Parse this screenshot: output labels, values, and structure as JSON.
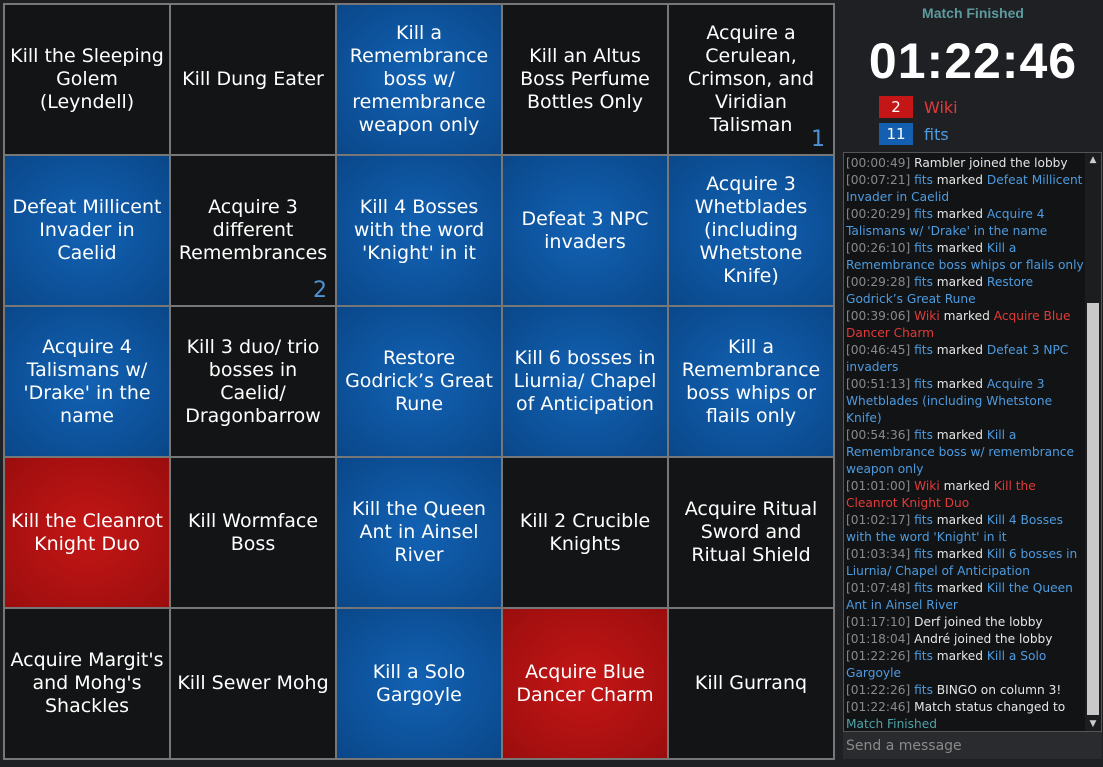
{
  "board": {
    "cells": [
      {
        "text": "Kill the Sleeping Golem (Leyndell)",
        "color": "none",
        "marker": ""
      },
      {
        "text": "Kill Dung Eater",
        "color": "none",
        "marker": ""
      },
      {
        "text": "Kill a Remembrance boss w/ remembrance weapon only",
        "color": "blue",
        "marker": ""
      },
      {
        "text": "Kill an Altus Boss Perfume Bottles Only",
        "color": "none",
        "marker": ""
      },
      {
        "text": "Acquire a Cerulean, Crimson, and Viridian Talisman",
        "color": "none",
        "marker": "1"
      },
      {
        "text": "Defeat Millicent Invader in Caelid",
        "color": "blue",
        "marker": ""
      },
      {
        "text": "Acquire 3 different Remembrances",
        "color": "none",
        "marker": "2"
      },
      {
        "text": "Kill 4 Bosses with the word 'Knight' in it",
        "color": "blue",
        "marker": ""
      },
      {
        "text": "Defeat 3 NPC invaders",
        "color": "blue",
        "marker": ""
      },
      {
        "text": "Acquire 3 Whetblades (including Whetstone Knife)",
        "color": "blue",
        "marker": ""
      },
      {
        "text": "Acquire 4 Talismans w/ 'Drake' in the name",
        "color": "blue",
        "marker": ""
      },
      {
        "text": "Kill 3 duo/ trio bosses in Caelid/ Dragonbarrow",
        "color": "none",
        "marker": ""
      },
      {
        "text": "Restore Godrick’s Great Rune",
        "color": "blue",
        "marker": ""
      },
      {
        "text": "Kill 6 bosses in Liurnia/ Chapel of Anticipation",
        "color": "blue",
        "marker": ""
      },
      {
        "text": "Kill a Remembrance boss whips or flails only",
        "color": "blue",
        "marker": ""
      },
      {
        "text": "Kill the Cleanrot Knight Duo",
        "color": "red",
        "marker": ""
      },
      {
        "text": "Kill Wormface Boss",
        "color": "none",
        "marker": ""
      },
      {
        "text": "Kill the Queen Ant in Ainsel River",
        "color": "blue",
        "marker": ""
      },
      {
        "text": "Kill 2 Crucible Knights",
        "color": "none",
        "marker": ""
      },
      {
        "text": "Acquire Ritual Sword and Ritual Shield",
        "color": "none",
        "marker": ""
      },
      {
        "text": "Acquire Margit's and Mohg's Shackles",
        "color": "none",
        "marker": ""
      },
      {
        "text": "Kill Sewer Mohg",
        "color": "none",
        "marker": ""
      },
      {
        "text": "Kill a Solo Gargoyle",
        "color": "blue",
        "marker": ""
      },
      {
        "text": "Acquire Blue Dancer Charm",
        "color": "red",
        "marker": ""
      },
      {
        "text": "Kill Gurranq",
        "color": "none",
        "marker": ""
      }
    ]
  },
  "status": {
    "title": "Match Finished",
    "timer": "01:22:46"
  },
  "teams": [
    {
      "count": "2",
      "name": "Wiki",
      "color": "#c41616"
    },
    {
      "count": "11",
      "name": "fits",
      "color": "#1460b0"
    }
  ],
  "chat": {
    "entries": [
      {
        "ts": "[00:00:49]",
        "player": "",
        "pcolor": "",
        "action": "Rambler joined the lobby",
        "goal": "",
        "gcolor": ""
      },
      {
        "ts": "[00:07:21]",
        "player": "fits",
        "pcolor": "blue",
        "action": " marked ",
        "goal": "Defeat Millicent Invader in Caelid",
        "gcolor": "blue"
      },
      {
        "ts": "[00:20:29]",
        "player": "fits",
        "pcolor": "blue",
        "action": " marked ",
        "goal": "Acquire 4 Talismans w/ 'Drake' in the name",
        "gcolor": "blue"
      },
      {
        "ts": "[00:26:10]",
        "player": "fits",
        "pcolor": "blue",
        "action": " marked ",
        "goal": "Kill a Remembrance boss whips or flails only",
        "gcolor": "blue"
      },
      {
        "ts": "[00:29:28]",
        "player": "fits",
        "pcolor": "blue",
        "action": " marked ",
        "goal": "Restore Godrick’s Great Rune",
        "gcolor": "blue"
      },
      {
        "ts": "[00:39:06]",
        "player": "Wiki",
        "pcolor": "red",
        "action": " marked ",
        "goal": "Acquire Blue Dancer Charm",
        "gcolor": "red"
      },
      {
        "ts": "[00:46:45]",
        "player": "fits",
        "pcolor": "blue",
        "action": " marked ",
        "goal": "Defeat 3 NPC invaders",
        "gcolor": "blue"
      },
      {
        "ts": "[00:51:13]",
        "player": "fits",
        "pcolor": "blue",
        "action": " marked ",
        "goal": "Acquire 3 Whetblades (including Whetstone Knife)",
        "gcolor": "blue"
      },
      {
        "ts": "[00:54:36]",
        "player": "fits",
        "pcolor": "blue",
        "action": " marked ",
        "goal": "Kill a Remembrance boss w/ remembrance weapon only",
        "gcolor": "blue"
      },
      {
        "ts": "[01:01:00]",
        "player": "Wiki",
        "pcolor": "red",
        "action": " marked ",
        "goal": "Kill the Cleanrot Knight Duo",
        "gcolor": "red"
      },
      {
        "ts": "[01:02:17]",
        "player": "fits",
        "pcolor": "blue",
        "action": " marked ",
        "goal": "Kill 4 Bosses with the word 'Knight' in it",
        "gcolor": "blue"
      },
      {
        "ts": "[01:03:34]",
        "player": "fits",
        "pcolor": "blue",
        "action": " marked ",
        "goal": "Kill 6 bosses in Liurnia/ Chapel of Anticipation",
        "gcolor": "blue"
      },
      {
        "ts": "[01:07:48]",
        "player": "fits",
        "pcolor": "blue",
        "action": " marked ",
        "goal": "Kill the Queen Ant in Ainsel River",
        "gcolor": "blue"
      },
      {
        "ts": "[01:17:10]",
        "player": "",
        "pcolor": "",
        "action": "Derf joined the lobby",
        "goal": "",
        "gcolor": ""
      },
      {
        "ts": "[01:18:04]",
        "player": "",
        "pcolor": "",
        "action": "André joined the lobby",
        "goal": "",
        "gcolor": ""
      },
      {
        "ts": "[01:22:26]",
        "player": "fits",
        "pcolor": "blue",
        "action": " marked ",
        "goal": "Kill a Solo Gargoyle",
        "gcolor": "blue"
      },
      {
        "ts": "[01:22:26]",
        "player": "fits",
        "pcolor": "blue",
        "action": " BINGO on column 3!",
        "goal": "",
        "gcolor": ""
      },
      {
        "ts": "[01:22:46]",
        "player": "",
        "pcolor": "",
        "action": "Match status changed to ",
        "goal": "Match Finished",
        "gcolor": "teal"
      }
    ],
    "input_placeholder": "Send a message"
  }
}
